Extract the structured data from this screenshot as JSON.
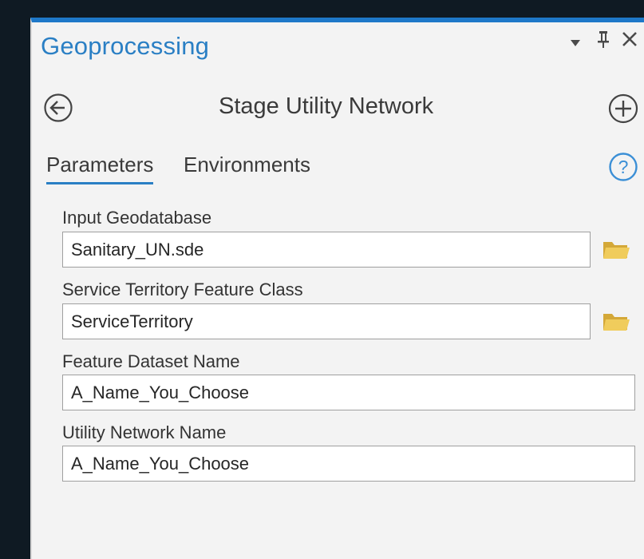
{
  "window": {
    "title": "Geoprocessing"
  },
  "tool": {
    "title": "Stage Utility Network"
  },
  "tabs": [
    {
      "label": "Parameters",
      "active": true
    },
    {
      "label": "Environments",
      "active": false
    }
  ],
  "parameters": [
    {
      "label": "Input Geodatabase",
      "value": "Sanitary_UN.sde",
      "browse_icon": "folder-icon"
    },
    {
      "label": "Service Territory Feature Class",
      "value": "ServiceTerritory",
      "browse_icon": "folder-icon"
    },
    {
      "label": "Feature Dataset Name",
      "value": "A_Name_You_Choose"
    },
    {
      "label": "Utility Network Name",
      "value": "A_Name_You_Choose"
    }
  ],
  "icons": {
    "dropdown": "chevron-down-icon",
    "pin": "pin-icon",
    "close": "close-icon",
    "back": "back-arrow-icon",
    "add": "plus-circle-icon",
    "help": "help-icon"
  },
  "colors": {
    "accent": "#2a7fc4",
    "folder": "#e6c052",
    "help": "#3b8fd6"
  }
}
